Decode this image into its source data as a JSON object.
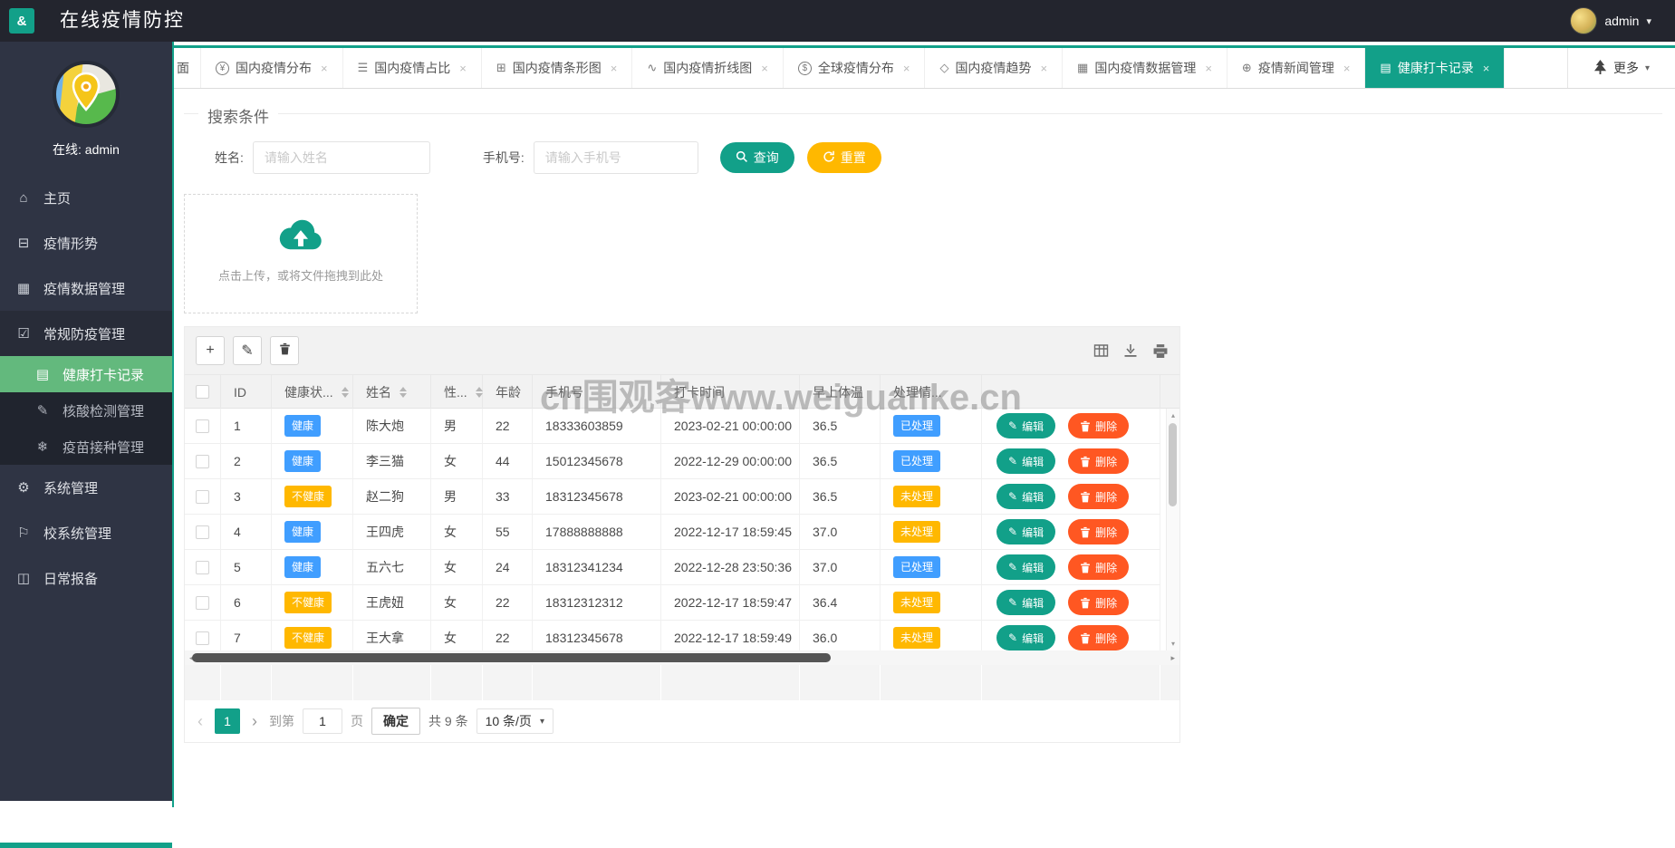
{
  "accent": {
    "teal": "#12a089",
    "yellow": "#ffb800",
    "blue": "#409eff",
    "orange": "#ff5722",
    "green": "#63b97d"
  },
  "app": {
    "logo_glyph": "&",
    "title": "在线疫情防控"
  },
  "header": {
    "user": "admin"
  },
  "icons": {
    "plus": "+",
    "pencil": "✎",
    "caret_down": "▾",
    "close": "×",
    "up": "▴",
    "down": "▾",
    "left": "◂",
    "right": "▸",
    "prev": "‹",
    "next": "›"
  },
  "sidebar": {
    "online_label": "在线: admin",
    "items": [
      {
        "key": "home",
        "icon": "home-icon",
        "glyph": "⌂",
        "label": "主页",
        "type": "item"
      },
      {
        "key": "epidemic-situation",
        "icon": "monitor-icon",
        "glyph": "⊟",
        "label": "疫情形势",
        "type": "item"
      },
      {
        "key": "epidemic-data-mgmt",
        "icon": "table-icon",
        "glyph": "▦",
        "label": "疫情数据管理",
        "type": "item"
      },
      {
        "key": "routine-prevention-mgmt",
        "icon": "shield-check-icon",
        "glyph": "☑",
        "label": "常规防疫管理",
        "type": "group"
      },
      {
        "key": "health-checkin-records",
        "icon": "clipboard-icon",
        "glyph": "▤",
        "label": "健康打卡记录",
        "type": "subitem",
        "active": true
      },
      {
        "key": "nucleic-acid-mgmt",
        "icon": "pen-icon",
        "glyph": "✎",
        "label": "核酸检测管理",
        "type": "subitem"
      },
      {
        "key": "vaccine-mgmt",
        "icon": "snowflake-icon",
        "glyph": "❄",
        "label": "疫苗接种管理",
        "type": "subitem"
      },
      {
        "key": "system-mgmt",
        "icon": "gear-icon",
        "glyph": "⚙",
        "label": "系统管理",
        "type": "item"
      },
      {
        "key": "school-system-mgmt",
        "icon": "flag-icon",
        "glyph": "⚐",
        "label": "校系统管理",
        "type": "item"
      },
      {
        "key": "daily-report",
        "icon": "book-icon",
        "glyph": "◫",
        "label": "日常报备",
        "type": "item"
      }
    ]
  },
  "tabs": {
    "more_label": "更多",
    "items": [
      {
        "key": "partial-first",
        "label": "面",
        "partial": true
      },
      {
        "key": "domestic-distribution",
        "icon": "yen-circle-icon",
        "glyph": "¥",
        "circle": true,
        "label": "国内疫情分布",
        "closable": true
      },
      {
        "key": "domestic-proportion",
        "icon": "layers-icon",
        "glyph": "☰",
        "label": "国内疫情占比",
        "closable": true
      },
      {
        "key": "domestic-bar-chart",
        "icon": "bar-grid-icon",
        "glyph": "⊞",
        "label": "国内疫情条形图",
        "closable": true
      },
      {
        "key": "domestic-line-chart",
        "icon": "line-chart-icon",
        "glyph": "∿",
        "label": "国内疫情折线图",
        "closable": true
      },
      {
        "key": "global-distribution",
        "icon": "dollar-circle-icon",
        "glyph": "$",
        "circle": true,
        "label": "全球疫情分布",
        "closable": true
      },
      {
        "key": "domestic-trend",
        "icon": "shield-icon",
        "glyph": "◇",
        "label": "国内疫情趋势",
        "closable": true
      },
      {
        "key": "domestic-data-mgmt",
        "icon": "table-icon",
        "glyph": "▦",
        "label": "国内疫情数据管理",
        "closable": true
      },
      {
        "key": "epidemic-news-mgmt",
        "icon": "globe-icon",
        "glyph": "⊕",
        "label": "疫情新闻管理",
        "closable": true
      },
      {
        "key": "health-checkin-records",
        "icon": "clipboard-icon",
        "glyph": "▤",
        "label": "健康打卡记录",
        "closable": true,
        "active": true
      }
    ]
  },
  "search": {
    "legend": "搜索条件",
    "name_label": "姓名:",
    "name_placeholder": "请输入姓名",
    "phone_label": "手机号:",
    "phone_placeholder": "请输入手机号",
    "query_label": "查询",
    "reset_label": "重置"
  },
  "upload": {
    "hint": "点击上传，或将文件拖拽到此处"
  },
  "table": {
    "watermark": "cn围观客www.weiguanke.cn",
    "headers": [
      {
        "type": "checkbox",
        "label": ""
      },
      {
        "label": "ID"
      },
      {
        "label": "健康状...",
        "sortable": true
      },
      {
        "label": "姓名",
        "sortable": true
      },
      {
        "label": "性...",
        "sortable": true
      },
      {
        "label": "年龄"
      },
      {
        "label": "手机号"
      },
      {
        "label": "打卡时间"
      },
      {
        "label": "早上体温"
      },
      {
        "label": "处理情..."
      },
      {
        "label": ""
      }
    ],
    "badge_colors": {
      "健康": "#409eff",
      "不健康": "#ffb800",
      "已处理": "#409eff",
      "未处理": "#ffb800"
    },
    "actions": {
      "edit": "编辑",
      "delete": "删除"
    },
    "rows": [
      {
        "id": "1",
        "health": "健康",
        "name": "陈大炮",
        "gender": "男",
        "age": "22",
        "phone": "18333603859",
        "time": "2023-02-21 00:00:00",
        "temp": "36.5",
        "status": "已处理"
      },
      {
        "id": "2",
        "health": "健康",
        "name": "李三猫",
        "gender": "女",
        "age": "44",
        "phone": "15012345678",
        "time": "2022-12-29 00:00:00",
        "temp": "36.5",
        "status": "已处理"
      },
      {
        "id": "3",
        "health": "不健康",
        "name": "赵二狗",
        "gender": "男",
        "age": "33",
        "phone": "18312345678",
        "time": "2023-02-21 00:00:00",
        "temp": "36.5",
        "status": "未处理"
      },
      {
        "id": "4",
        "health": "健康",
        "name": "王四虎",
        "gender": "女",
        "age": "55",
        "phone": "17888888888",
        "time": "2022-12-17 18:59:45",
        "temp": "37.0",
        "status": "未处理"
      },
      {
        "id": "5",
        "health": "健康",
        "name": "五六七",
        "gender": "女",
        "age": "24",
        "phone": "18312341234",
        "time": "2022-12-28 23:50:36",
        "temp": "37.0",
        "status": "已处理"
      },
      {
        "id": "6",
        "health": "不健康",
        "name": "王虎妞",
        "gender": "女",
        "age": "22",
        "phone": "18312312312",
        "time": "2022-12-17 18:59:47",
        "temp": "36.4",
        "status": "未处理"
      },
      {
        "id": "7",
        "health": "不健康",
        "name": "王大拿",
        "gender": "女",
        "age": "22",
        "phone": "18312345678",
        "time": "2022-12-17 18:59:49",
        "temp": "36.0",
        "status": "未处理"
      }
    ]
  },
  "pagination": {
    "page": "1",
    "goto_label": "到第",
    "goto_value": "1",
    "page_unit": "页",
    "confirm_label": "确定",
    "total_label": "共 9 条",
    "size_label": "10 条/页"
  }
}
